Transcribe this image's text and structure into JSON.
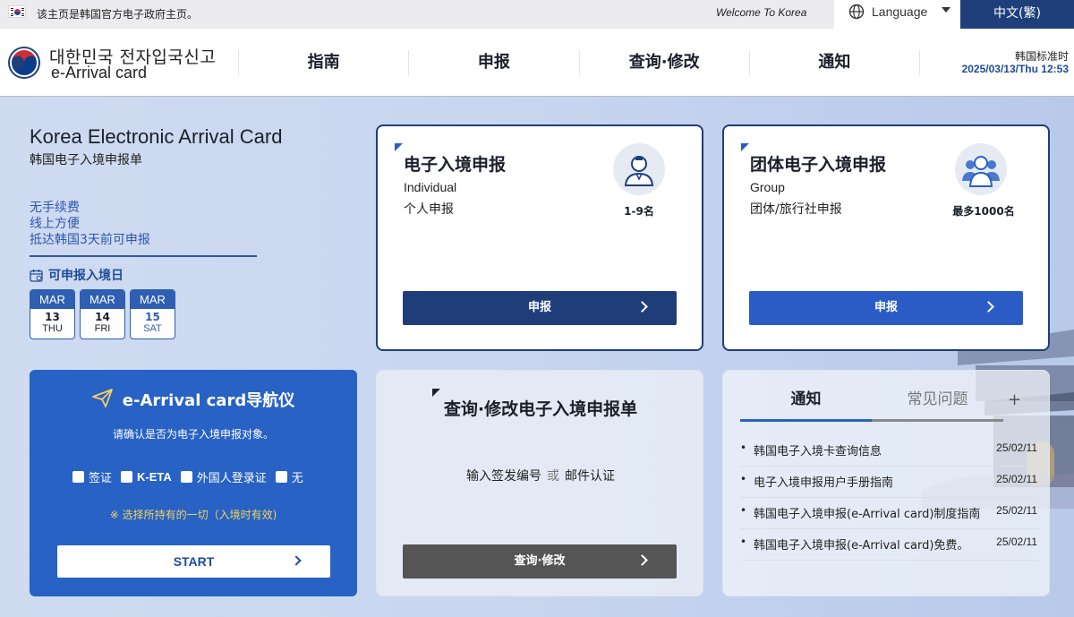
{
  "topbar": {
    "notice": "该主页是韩国官方电子政府主页。",
    "welcome": "Welcome To Korea",
    "language_label": "Language",
    "current_language": "中文(繁)"
  },
  "header": {
    "logo_korean": "대한민국 전자입국신고",
    "logo_english": "e-Arrival card",
    "nav": [
      "指南",
      "申报",
      "查询·修改",
      "通知"
    ],
    "time_label": "韩国标准时",
    "time_value": "2025/03/13/Thu 12:53"
  },
  "info": {
    "title": "Korea Electronic Arrival Card",
    "subtitle": "韩国电子入境申报单",
    "features": [
      "无手续费",
      "线上方便",
      "抵达韩国3天前可申报"
    ],
    "date_label": "可申报入境日",
    "dates": [
      {
        "month": "MAR",
        "day": "13",
        "weekday": "THU"
      },
      {
        "month": "MAR",
        "day": "14",
        "weekday": "FRI"
      },
      {
        "month": "MAR",
        "day": "15",
        "weekday": "SAT"
      }
    ]
  },
  "individual": {
    "title": "电子入境申报",
    "en": "Individual",
    "zh": "个人申报",
    "count": "1-9名",
    "button": "申报"
  },
  "group": {
    "title": "团体电子入境申报",
    "en": "Group",
    "zh": "团体/旅行社申报",
    "count": "最多1000名",
    "button": "申报"
  },
  "navigator": {
    "title": "e-Arrival card导航仪",
    "desc": "请确认是否为电子入境申报对象。",
    "options": [
      "签证",
      "K-ETA",
      "外国人登录证",
      "无"
    ],
    "hint": "※ 选择所持有的一切（入境时有效)",
    "start": "START"
  },
  "inquiry": {
    "title": "查询·修改电子入境申报单",
    "desc_left": "输入签发编号",
    "desc_or": "或",
    "desc_right": "邮件认证",
    "button": "查询·修改"
  },
  "notices": {
    "tab_active": "通知",
    "tab_inactive": "常见问题",
    "more": "+",
    "items": [
      {
        "text": "韩国电子入境卡查询信息",
        "date": "25/02/11"
      },
      {
        "text": "电子入境申报用户手册指南",
        "date": "25/02/11"
      },
      {
        "text": "韩国电子入境申报(e-Arrival card)制度指南",
        "date": "25/02/11"
      },
      {
        "text": "韩国电子入境申报(e-Arrival card)免费。",
        "date": "25/02/11"
      }
    ]
  },
  "colors": {
    "navy": "#1e3f7a",
    "blue": "#2762c4",
    "button_dark": "#1f3e79",
    "button_blue": "#2b5cc6",
    "button_gray": "#555555",
    "hint_yellow": "#f4d35e"
  }
}
